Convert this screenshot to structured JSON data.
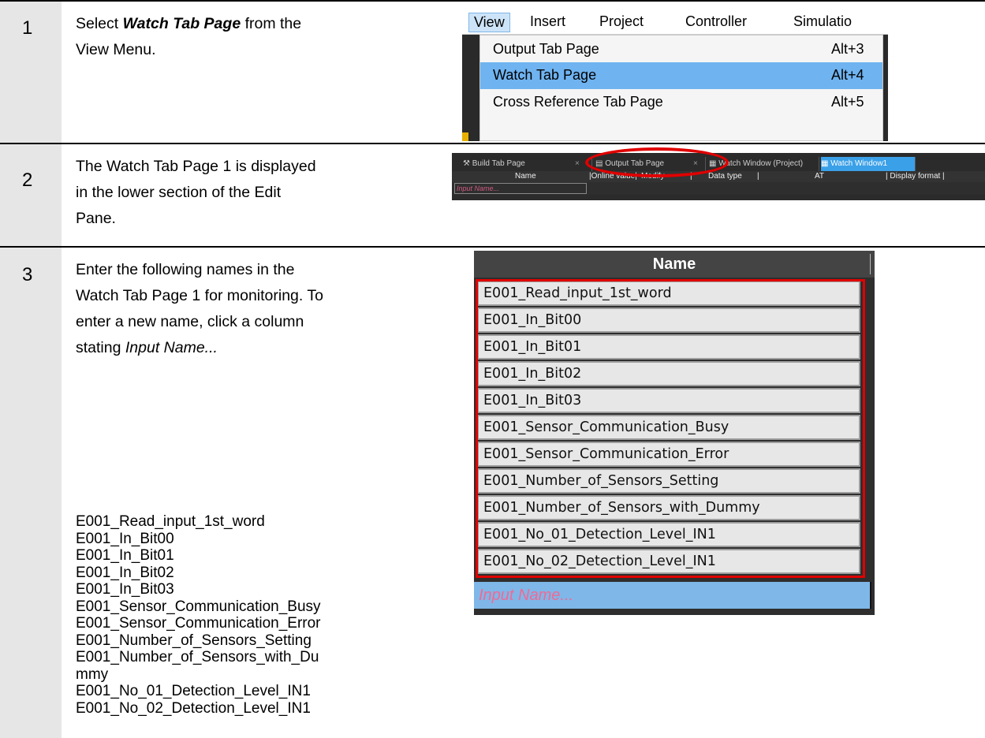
{
  "steps": [
    {
      "number": "1",
      "text_before": "Select ",
      "text_emph": "Watch Tab Page",
      "text_after": " from the",
      "text_line2": "View Menu."
    },
    {
      "number": "2",
      "lines": [
        "The Watch Tab Page 1 is displayed",
        "in the lower section of the Edit",
        "Pane."
      ]
    },
    {
      "number": "3",
      "lines": [
        "Enter the following names in the",
        "Watch Tab Page 1 for monitoring. To",
        "enter a new name, click a column"
      ],
      "line4_prefix": "stating ",
      "line4_emph": "Input Name...",
      "names": [
        "E001_Read_input_1st_word",
        "E001_In_Bit00",
        "E001_In_Bit01",
        "E001_In_Bit02",
        "E001_In_Bit03",
        "E001_Sensor_Communication_Busy",
        "E001_Sensor_Communication_Error",
        "E001_Number_of_Sensors_Setting",
        "E001_Number_of_Sensors_with_Du",
        "mmy",
        "E001_No_01_Detection_Level_IN1",
        "E001_No_02_Detection_Level_IN1"
      ]
    }
  ],
  "screenshot_menu": {
    "menubar": [
      "View",
      "Insert",
      "Project",
      "Controller",
      "Simulatio"
    ],
    "items": [
      {
        "label": "Output Tab Page",
        "shortcut": "Alt+3",
        "selected": false
      },
      {
        "label": "Watch Tab Page",
        "shortcut": "Alt+4",
        "selected": true
      },
      {
        "label": "Cross Reference Tab Page",
        "shortcut": "Alt+5",
        "selected": false
      }
    ],
    "highlight_color": "#6fb3f0"
  },
  "screenshot_tabs": {
    "tabs": [
      "Build Tab Page",
      "Output Tab Page",
      "Watch Window (Project)",
      "Watch Window1"
    ],
    "close_glyph": "×",
    "columns": [
      "Name",
      "|Online value|",
      "Modify",
      "|",
      "Data type",
      "|",
      "AT",
      "| Display format |"
    ],
    "input_placeholder": "Input Name..."
  },
  "screenshot_names": {
    "header": "Name",
    "rows": [
      "E001_Read_input_1st_word",
      "E001_In_Bit00",
      "E001_In_Bit01",
      "E001_In_Bit02",
      "E001_In_Bit03",
      "E001_Sensor_Communication_Busy",
      "E001_Sensor_Communication_Error",
      "E001_Number_of_Sensors_Setting",
      "E001_Number_of_Sensors_with_Dummy",
      "E001_No_01_Detection_Level_IN1",
      "E001_No_02_Detection_Level_IN1"
    ],
    "input_placeholder": "Input Name...",
    "highlight_color": "#e00000"
  }
}
